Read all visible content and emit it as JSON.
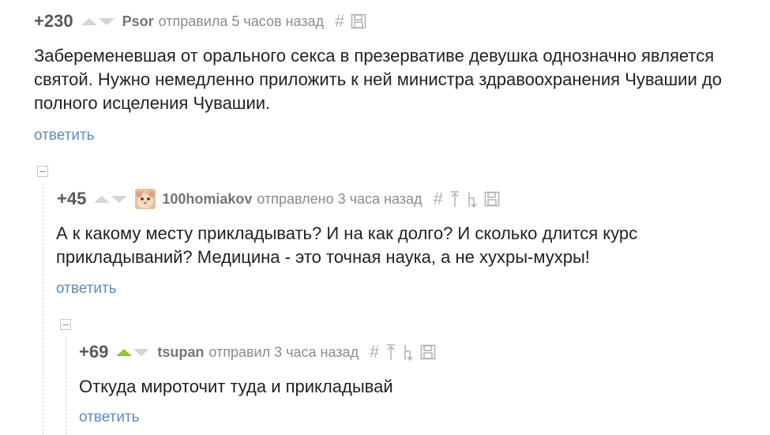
{
  "comments": [
    {
      "score": "+230",
      "author": "Psor",
      "meta": "отправила 5 часов назад",
      "hash": "#",
      "text": "Забеременевшая от орального секса в презервативе девушка однозначно является святой. Нужно немедленно приложить к ней министра здравоохранения Чувашии до полного исцеления Чувашии.",
      "reply": "ответить",
      "icons": [
        "hash-icon",
        "save-icon"
      ]
    },
    {
      "score": "+45",
      "author": "100homiakov",
      "meta": "отправлено 3 часа назад",
      "hash": "#",
      "text": "А к какому месту прикладывать? И на как долго? И сколько длится курс прикладываний? Медицина - это точная наука, а не хухры-мухры!",
      "reply": "ответить",
      "icons": [
        "hash-icon",
        "arrow-up-parent-icon",
        "tree-branch-icon",
        "save-icon"
      ],
      "avatar": "hamster-avatar"
    },
    {
      "score": "+69",
      "author": "tsupan",
      "meta": "отправил 3 часа назад",
      "hash": "#",
      "text": "Откуда мироточит туда и прикладывай",
      "reply": "ответить",
      "upvoted": true,
      "icons": [
        "hash-icon",
        "arrow-up-parent-icon",
        "tree-branch-icon",
        "save-icon"
      ]
    }
  ],
  "colors": {
    "reply_link": "#5f8bbf",
    "upvote_active": "#95c534",
    "vote_inactive": "#d5d5d5"
  }
}
